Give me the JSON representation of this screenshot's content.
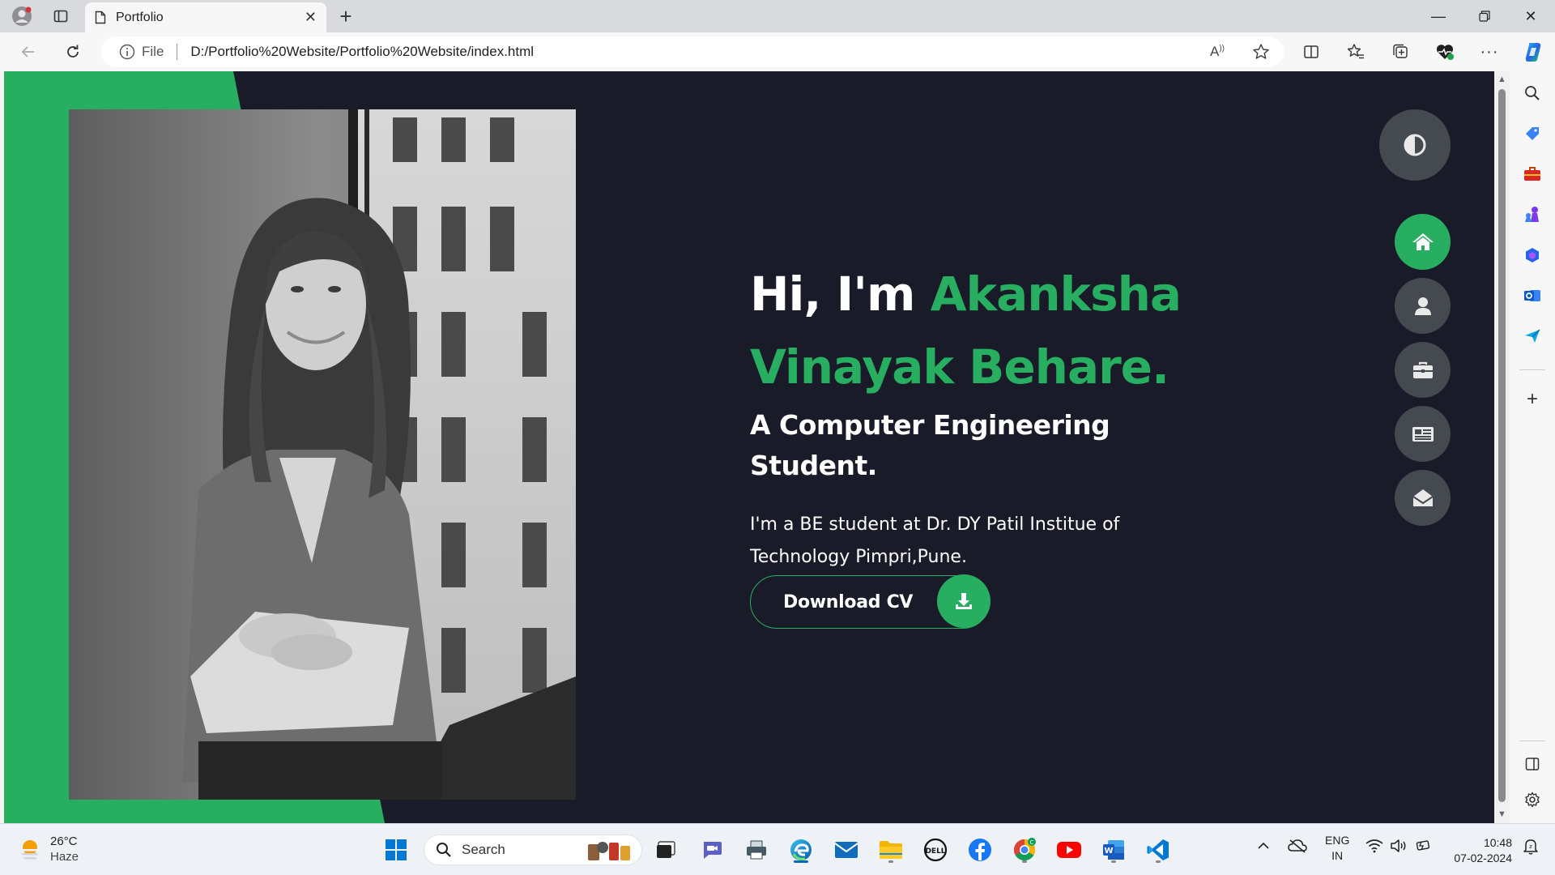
{
  "browser": {
    "tab_title": "Portfolio",
    "address_prefix": "File",
    "url": "D:/Portfolio%20Website/Portfolio%20Website/index.html"
  },
  "hero": {
    "greeting": "Hi, I'm ",
    "name_line1": "Akanksha",
    "name_line2": "Vinayak Behare.",
    "subtitle_line1": "A Computer Engineering",
    "subtitle_line2": "Student.",
    "description": "I'm a BE student at Dr. DY Patil Institue of Technology Pimpri,Pune.",
    "download_label": "Download CV"
  },
  "side_nav": [
    {
      "name": "home",
      "icon": "home-icon",
      "active": true
    },
    {
      "name": "about",
      "icon": "user-icon",
      "active": false
    },
    {
      "name": "portfolio",
      "icon": "briefcase-icon",
      "active": false
    },
    {
      "name": "blogs",
      "icon": "newspaper-icon",
      "active": false
    },
    {
      "name": "contact",
      "icon": "envelope-open-icon",
      "active": false
    }
  ],
  "colors": {
    "accent": "#27ae60",
    "page_bg": "#1a1b29",
    "nav_circle": "#454950"
  },
  "taskbar": {
    "temperature": "26°C",
    "weather": "Haze",
    "search_label": "Search",
    "lang_line1": "ENG",
    "lang_line2": "IN",
    "time": "10:48",
    "date": "07-02-2024"
  }
}
